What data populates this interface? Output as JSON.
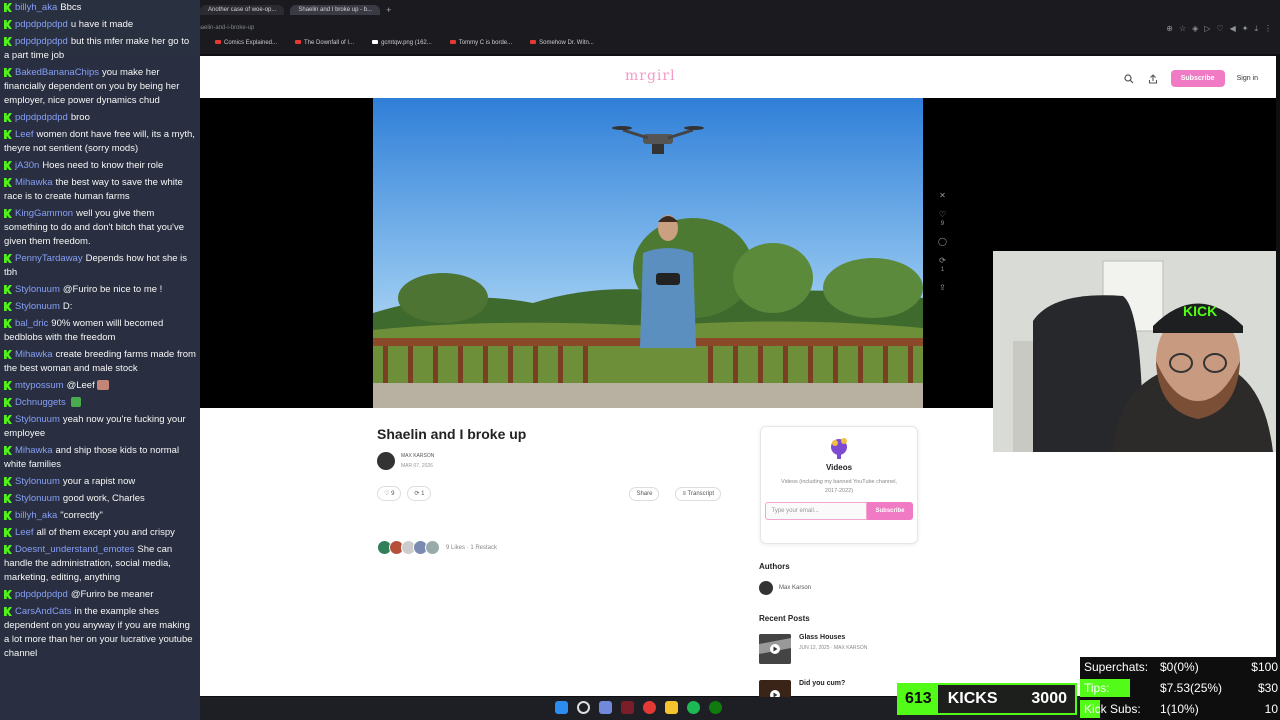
{
  "browser": {
    "tabs": [
      "Another case of woe-op...",
      "Shaelin and I broke up - b..."
    ],
    "url": "maxkarson.substack.com/p/shaelin-and-i-broke-up",
    "bookmarks": [
      "Comics Explained...",
      "The Downfall of I...",
      "gcmtqw.png (162...",
      "Tommy C is borde...",
      "Somehow Dr. Witn..."
    ]
  },
  "site": {
    "logo": "mrgirl",
    "subscribe": "Subscribe",
    "signin": "Sign in"
  },
  "post": {
    "title": "Shaelin and I broke up",
    "author": "MAX KARSON",
    "date": "MAR 07, 2026",
    "likes": "9",
    "restacks": "1",
    "share": "Share",
    "transcript": "Transcript",
    "likes_summary": "9 Likes · 1 Restack",
    "side_likes": "9",
    "side_restacks": "1"
  },
  "sidebar": {
    "pub_title": "Videos",
    "pub_desc": "Videos (including my banned YouTube channel, 2017-2022)",
    "email_placeholder": "Type your email...",
    "subscribe": "Subscribe",
    "authors_title": "Authors",
    "author_name": "Max Karson",
    "recent_title": "Recent Posts",
    "recent": [
      {
        "title": "Glass Houses",
        "meta": "JUN 12, 2025 · MAX KARSON"
      },
      {
        "title": "Did you cum?",
        "meta": ""
      }
    ]
  },
  "chat": [
    {
      "user": "billyh_aka",
      "text": "Bbcs"
    },
    {
      "user": "pdpdpdpdpd",
      "text": "u have it made"
    },
    {
      "user": "pdpdpdpdpd",
      "text": "but this mfer make her go to a part time job"
    },
    {
      "user": "BakedBananaChips",
      "text": "you make her financially dependent on you by being her employer, nice power dynamics chud"
    },
    {
      "user": "pdpdpdpdpd",
      "text": "broo"
    },
    {
      "user": "Leef",
      "text": "women dont have free will, its a myth, theyre not sentient (sorry mods)"
    },
    {
      "user": "jA30n",
      "text": "Hoes need to know their role"
    },
    {
      "user": "Mihawka",
      "text": "the best way to save the white race is to create human farms"
    },
    {
      "user": "KingGammon",
      "text": "well you give them something to do and don't bitch that you've given them freedom."
    },
    {
      "user": "PennyTardaway",
      "text": "Depends how hot she is tbh"
    },
    {
      "user": "Stylonuum",
      "text": "@Furiro be nice to me !"
    },
    {
      "user": "Stylonuum",
      "text": "D:"
    },
    {
      "user": "bal_dric",
      "text": "90% women willl becomed bedblobs with the freedom"
    },
    {
      "user": "Mihawka",
      "text": "create breeding farms made from the best woman and male stock"
    },
    {
      "user": "mtypossum",
      "text": "@Leef"
    },
    {
      "user": "Dchnuggets",
      "text": ""
    },
    {
      "user": "Stylonuum",
      "text": "yeah now you're fucking your employee"
    },
    {
      "user": "Mihawka",
      "text": "and ship those kids to normal white families"
    },
    {
      "user": "Stylonuum",
      "text": "your a rapist now"
    },
    {
      "user": "Stylonuum",
      "text": "good work, Charles"
    },
    {
      "user": "billyh_aka",
      "text": "\"correctly\""
    },
    {
      "user": "Leef",
      "text": "all of them except you and crispy"
    },
    {
      "user": "Doesnt_understand_emotes",
      "text": "She can handle the administration, social media, marketing, editing, anything"
    },
    {
      "user": "pdpdpdpdpd",
      "text": "@Furiro be meaner"
    },
    {
      "user": "CarsAndCats",
      "text": "in the example shes dependent on you anyway if you are making a lot more than her on your lucrative youtube channel"
    }
  ],
  "kicks": {
    "count": "613",
    "label": "KICKS",
    "goal": "3000"
  },
  "stats": [
    {
      "label": "Superchats:",
      "value": "$0(0%)",
      "goal": "$100",
      "fraction": 0
    },
    {
      "label": "Tips:",
      "value": "$7.53(25%)",
      "goal": "$30",
      "fraction": 0.25
    },
    {
      "label": "Kick Subs:",
      "value": "1(10%)",
      "goal": "10",
      "fraction": 0.1
    }
  ],
  "colors": {
    "kick_green": "#53fc18",
    "brand_pink": "#f07ac4",
    "chat_bg": "#2a3142"
  }
}
